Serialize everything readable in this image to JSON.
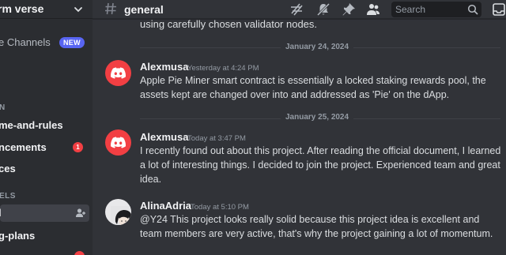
{
  "sidebar": {
    "server_name": "rm verse",
    "browse_channels": "e Channels",
    "new_badge": "NEW",
    "category_1": "N",
    "channels": [
      {
        "label": "me-and-rules"
      },
      {
        "label": "ncements",
        "badge": "1"
      },
      {
        "label": "ces"
      }
    ],
    "category_2": "ELS",
    "voice_channels": [
      {
        "label": "l"
      },
      {
        "label": "g-plans"
      }
    ]
  },
  "header": {
    "channel_name": "general",
    "search_placeholder": "Search"
  },
  "main": {
    "continued_text": "using carefully chosen validator nodes.",
    "dividers": [
      "January 24, 2024",
      "January 25, 2024"
    ],
    "messages": [
      {
        "author": "Alexmusa",
        "timestamp": "Yesterday at 4:24 PM",
        "text": "Apple Pie Miner smart contract is essentially a locked staking rewards pool, the assets kept are changed over into and addressed as 'Pie' on the dApp."
      },
      {
        "author": "Alexmusa",
        "timestamp": "Today at 3:47 PM",
        "text": "I recently found out about this project. After reading the official document, I learned a lot of interesting things. I decided to join the project. Experienced team and great idea."
      },
      {
        "author": "AlinaAdria",
        "timestamp": "Today at 5:10 PM",
        "text": "@Y24 This project looks really solid because this project idea is excellent and team members are very active, that's why the project gaining a lot of momentum."
      }
    ]
  },
  "colors": {
    "accent": "#5865f2",
    "discord_red": "#f23f43",
    "bg_main": "#313338",
    "bg_sidebar": "#2b2d31"
  }
}
